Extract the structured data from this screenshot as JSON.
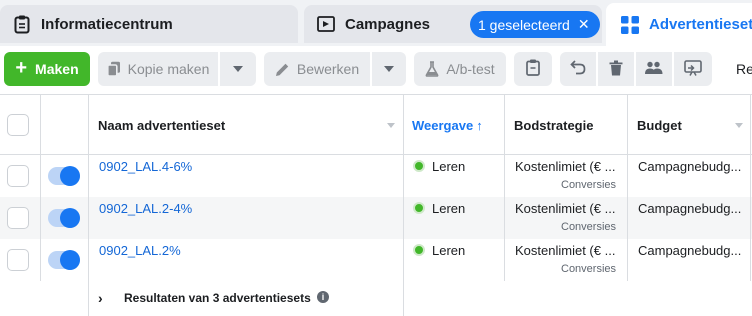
{
  "tabs": {
    "info": {
      "label": "Informatiecentrum",
      "icon": "clipboard-icon"
    },
    "campaigns": {
      "label": "Campagnes",
      "icon": "campaign-flag-icon"
    },
    "selection_pill": {
      "label": "1 geselecteerd",
      "close": "✕"
    },
    "adsets": {
      "label": "Advertentiesets",
      "icon": "grid-icon"
    }
  },
  "toolbar": {
    "make": "Maken",
    "copy": "Kopie maken",
    "edit": "Bewerken",
    "ab_test": "A/b-test",
    "overflow": "Re"
  },
  "table": {
    "headers": {
      "name": "Naam advertentieset",
      "delivery": "Weergave",
      "delivery_sort": "↑",
      "bid": "Bodstrategie",
      "budget": "Budget"
    },
    "rows": [
      {
        "name": "0902_LAL.4-6%",
        "delivery": "Leren",
        "bid": "Kostenlimiet (€ ...",
        "bid_sub": "Conversies",
        "budget": "Campagnebudg..."
      },
      {
        "name": "0902_LAL.2-4%",
        "delivery": "Leren",
        "bid": "Kostenlimiet (€ ...",
        "bid_sub": "Conversies",
        "budget": "Campagnebudg..."
      },
      {
        "name": "0902_LAL.2%",
        "delivery": "Leren",
        "bid": "Kostenlimiet (€ ...",
        "bid_sub": "Conversies",
        "budget": "Campagnebudg..."
      }
    ],
    "footer": "Resultaten van 3 advertentiesets"
  },
  "colors": {
    "accent": "#1877f2",
    "create": "#42b72a",
    "link": "#1467d6"
  }
}
